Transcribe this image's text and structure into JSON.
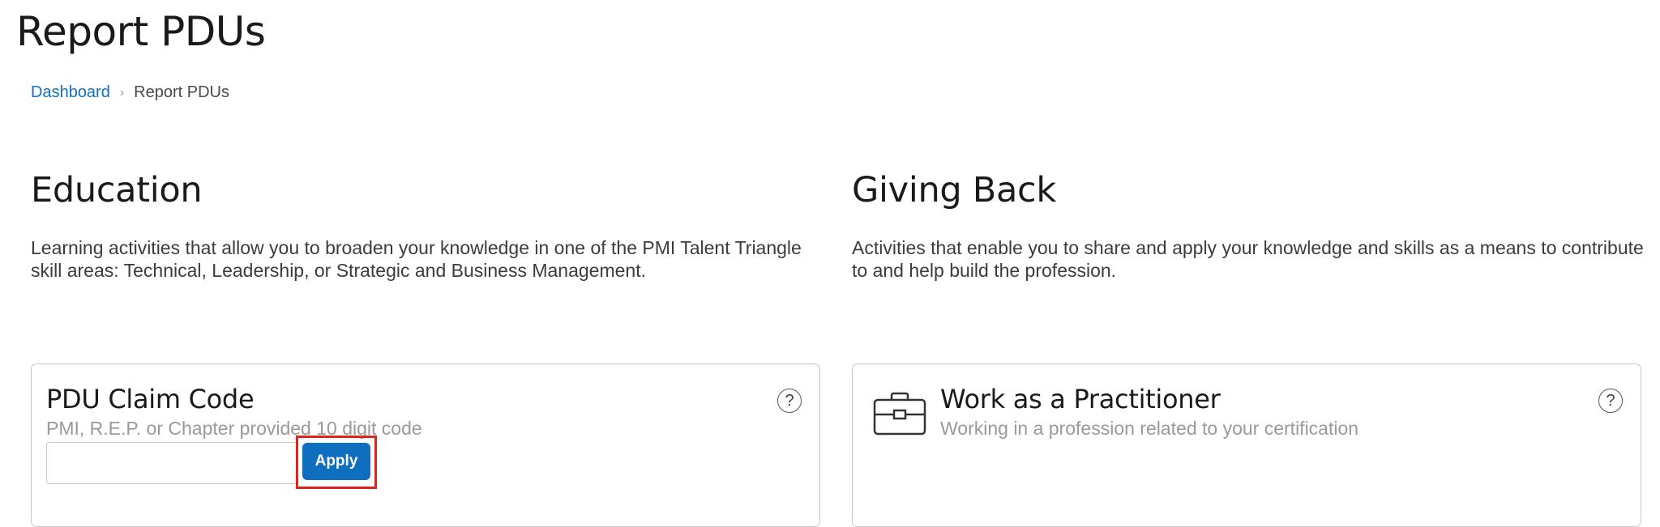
{
  "page": {
    "title": "Report PDUs"
  },
  "breadcrumb": {
    "home": "Dashboard",
    "separator": "›",
    "current": "Report PDUs"
  },
  "education": {
    "heading": "Education",
    "description": "Learning activities that allow you to broaden your knowledge in one of the PMI Talent Triangle skill areas: Technical, Leadership, or Strategic and Business Management."
  },
  "giving_back": {
    "heading": "Giving Back",
    "description": "Activities that enable you to share and apply your knowledge and skills as a means to contribute to and help build the profession."
  },
  "claim_card": {
    "title": "PDU Claim Code",
    "subtitle": "PMI, R.E.P. or Chapter provided 10 digit code",
    "input_value": "",
    "apply_label": "Apply",
    "help_icon": "question-circle-icon",
    "help_glyph": "?"
  },
  "practitioner_card": {
    "title": "Work as a Practitioner",
    "subtitle": "Working in a profession related to your certification",
    "icon": "briefcase-icon",
    "help_icon": "question-circle-icon",
    "help_glyph": "?"
  },
  "colors": {
    "link": "#1070c0",
    "primary_button": "#0f6fbe",
    "highlight": "#e2231a",
    "border": "#c9c9c9",
    "muted_text": "#9a9a9a"
  }
}
